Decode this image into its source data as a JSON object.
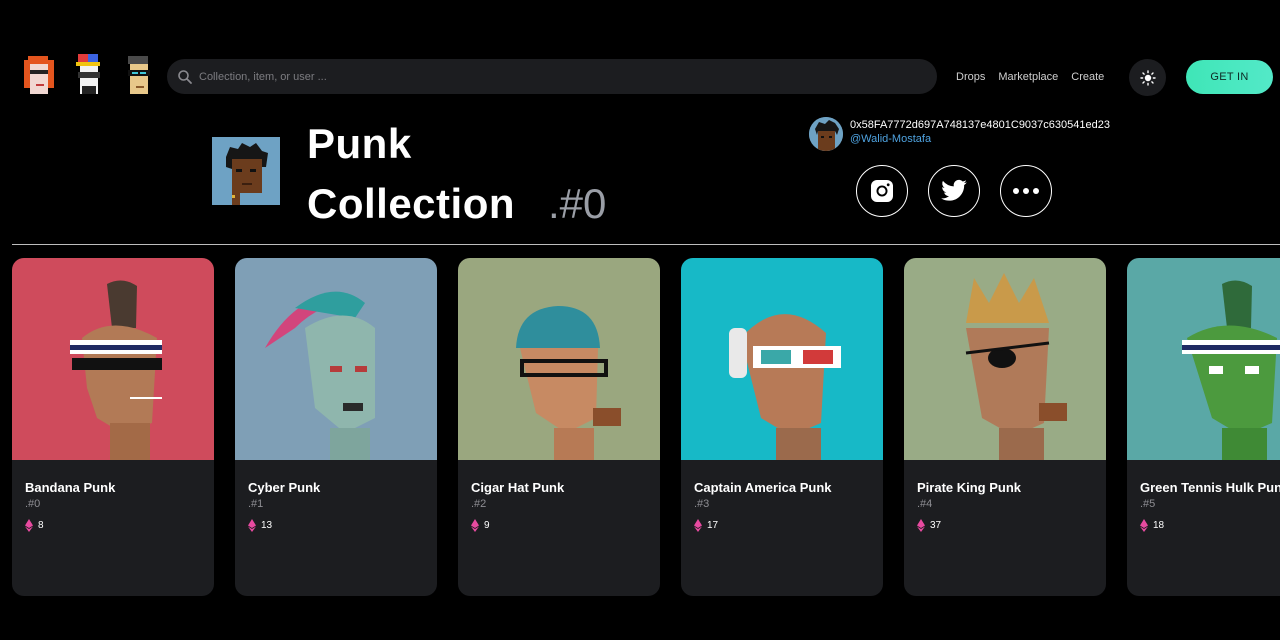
{
  "nav": {
    "search_placeholder": "Collection, item, or user ...",
    "links": [
      "Drops",
      "Marketplace",
      "Create"
    ],
    "cta_label": "GET IN",
    "icons": [
      "punk-logo-red-hair",
      "punk-logo-cap",
      "punk-logo-shades",
      "search-icon",
      "sun-icon"
    ],
    "colors": {
      "cta": "#3fe6b7",
      "accent_link": "#4fa3e0",
      "eth": "#e84aa0"
    }
  },
  "collection": {
    "title_line1": "Punk",
    "title_line2": "Collection",
    "number": ".#0"
  },
  "owner": {
    "address": "0x58FA7772d697A748137e4801C9037c630541ed23",
    "handle": "@Walid-Mostafa"
  },
  "social_icons": [
    "instagram-icon",
    "twitter-icon",
    "more-icon"
  ],
  "cards": [
    {
      "name": "Bandana Punk",
      "id": ".#0",
      "price": "8",
      "bg": "#cf4b5c"
    },
    {
      "name": "Cyber Punk",
      "id": ".#1",
      "price": "13",
      "bg": "#7f9fb6"
    },
    {
      "name": "Cigar Hat Punk",
      "id": ".#2",
      "price": "9",
      "bg": "#9aa77f"
    },
    {
      "name": "Captain America Punk",
      "id": ".#3",
      "price": "17",
      "bg": "#17b9c7"
    },
    {
      "name": "Pirate King Punk",
      "id": ".#4",
      "price": "37",
      "bg": "#99ab86"
    },
    {
      "name": "Green Tennis Hulk Punk",
      "id": ".#5",
      "price": "18",
      "bg": "#5aa8a6"
    }
  ]
}
